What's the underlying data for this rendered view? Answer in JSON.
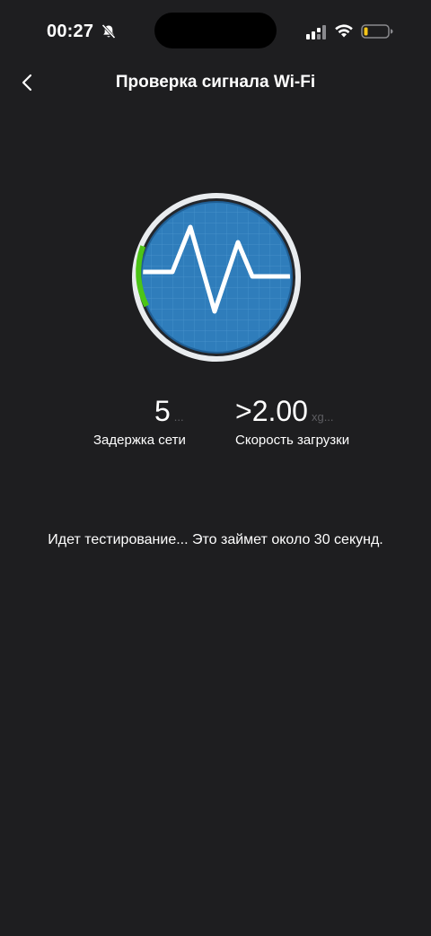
{
  "status_bar": {
    "time": "00:27"
  },
  "nav": {
    "title": "Проверка сигнала Wi-Fi"
  },
  "stats": {
    "latency": {
      "value": "5",
      "unit": "...",
      "label": "Задержка сети"
    },
    "download": {
      "value": ">2.00",
      "unit": "xg...",
      "label": "Скорость загрузки"
    }
  },
  "status_message": "Идет тестирование... Это займет около 30 секунд.",
  "colors": {
    "background": "#1e1e20",
    "gauge_fill": "#2f7dbb",
    "gauge_progress": "#4cc417",
    "text_muted": "#5e5e62"
  }
}
